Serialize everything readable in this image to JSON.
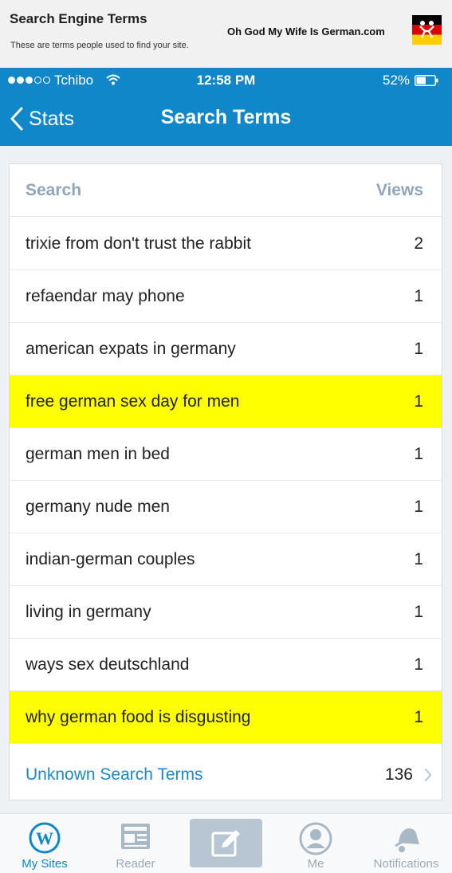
{
  "banner": {
    "title": "Search Engine Terms",
    "subtitle": "These are terms people used to find your site.",
    "brand": "Oh God My Wife Is German.com"
  },
  "status_bar": {
    "carrier": "Tchibo",
    "time": "12:58 PM",
    "battery": "52%",
    "signal_filled": 3,
    "signal_total": 5,
    "battery_level": 0.52
  },
  "nav": {
    "back_label": "Stats",
    "title": "Search Terms"
  },
  "table": {
    "header": {
      "term": "Search",
      "views": "Views"
    },
    "rows": [
      {
        "term": "trixie from don't trust the rabbit",
        "views": "2",
        "highlight": false
      },
      {
        "term": "refaendar may phone",
        "views": "1",
        "highlight": false
      },
      {
        "term": "american expats in germany",
        "views": "1",
        "highlight": false
      },
      {
        "term": "free german sex day for men",
        "views": "1",
        "highlight": true
      },
      {
        "term": "german men in bed",
        "views": "1",
        "highlight": false
      },
      {
        "term": "germany nude men",
        "views": "1",
        "highlight": false
      },
      {
        "term": "indian-german couples",
        "views": "1",
        "highlight": false
      },
      {
        "term": "living in germany",
        "views": "1",
        "highlight": false
      },
      {
        "term": "ways sex deutschland",
        "views": "1",
        "highlight": false
      },
      {
        "term": "why german food is disgusting",
        "views": "1",
        "highlight": true
      }
    ],
    "unknown": {
      "term": "Unknown Search Terms",
      "views": "136"
    }
  },
  "tabs": [
    {
      "label": "My Sites",
      "icon": "wordpress-icon",
      "active": true
    },
    {
      "label": "Reader",
      "icon": "reader-icon",
      "active": false
    },
    {
      "label": "",
      "icon": "write-icon",
      "active": false
    },
    {
      "label": "Me",
      "icon": "me-icon",
      "active": false
    },
    {
      "label": "Notifications",
      "icon": "notifications-icon",
      "active": false
    }
  ],
  "colors": {
    "header_blue": "#0f87c9",
    "highlight_yellow": "#ffff00",
    "link_blue": "#1d87c7",
    "muted": "#9aabb9"
  }
}
